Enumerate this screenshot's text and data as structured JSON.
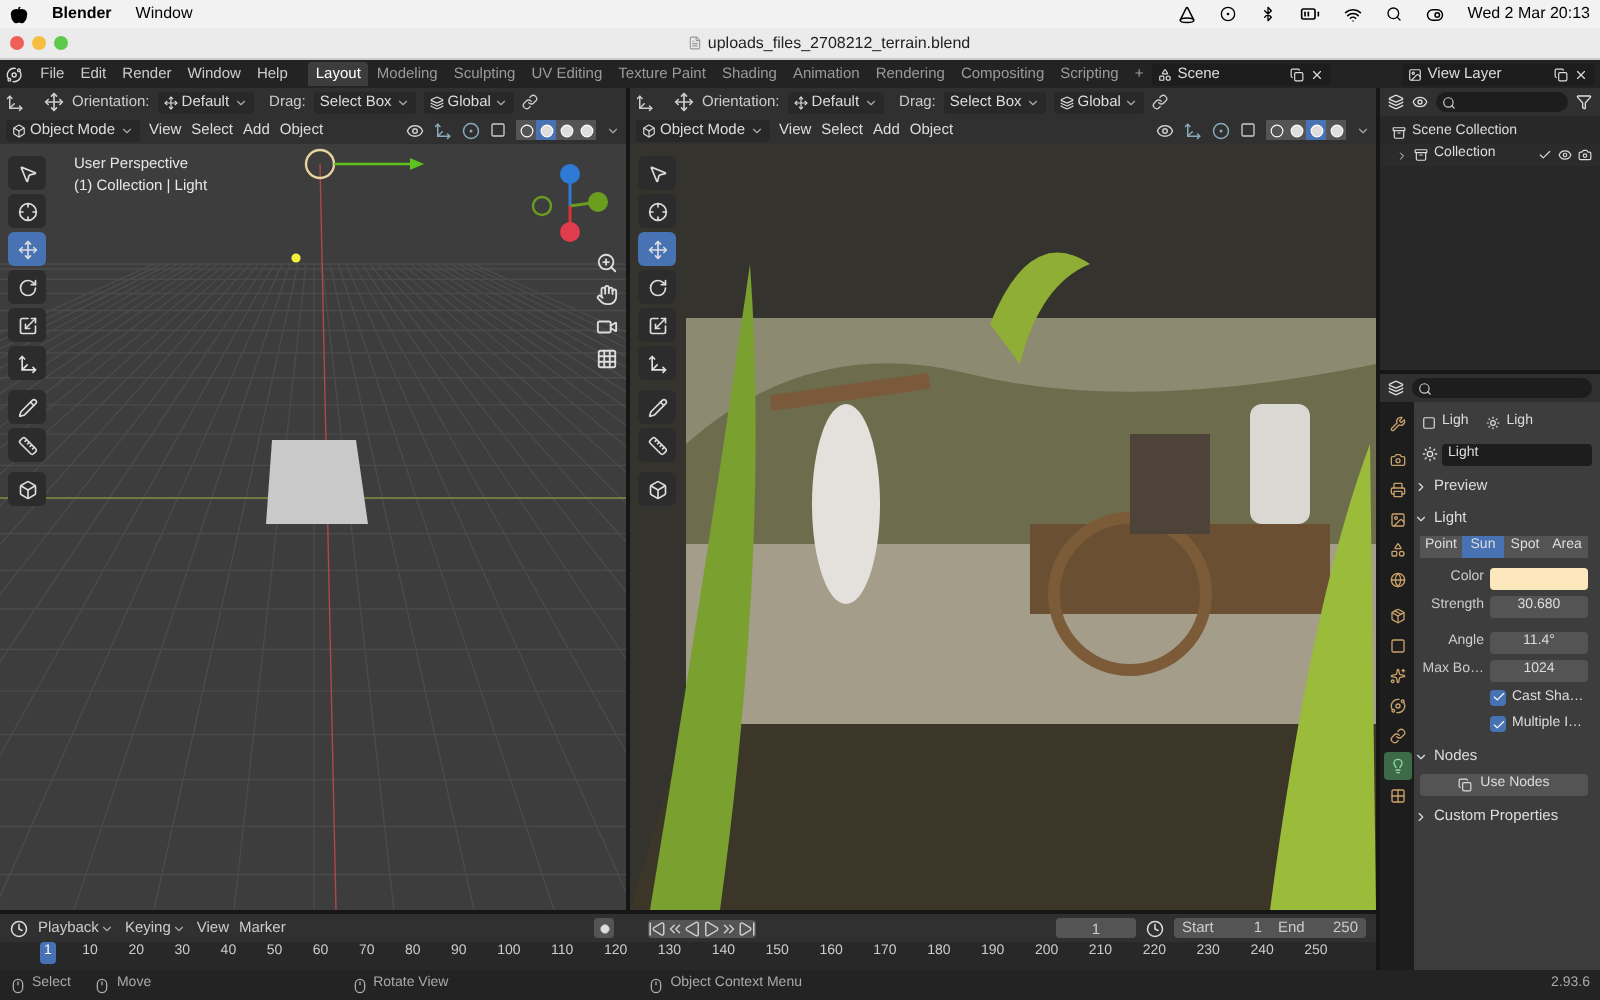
{
  "system_menu_bar": {
    "app_name": "Blender",
    "menus": [
      "Window"
    ],
    "clock": "Wed 2 Mar 20:13"
  },
  "window": {
    "title": "uploads_files_2708212_terrain.blend"
  },
  "top_bar": {
    "menus": [
      "File",
      "Edit",
      "Render",
      "Window",
      "Help"
    ],
    "workspaces": [
      {
        "label": "Layout",
        "selected": true
      },
      {
        "label": "Modeling",
        "selected": false
      },
      {
        "label": "Sculpting",
        "selected": false
      },
      {
        "label": "UV Editing",
        "selected": false
      },
      {
        "label": "Texture Paint",
        "selected": false
      },
      {
        "label": "Shading",
        "selected": false
      },
      {
        "label": "Animation",
        "selected": false
      },
      {
        "label": "Rendering",
        "selected": false
      },
      {
        "label": "Compositing",
        "selected": false
      },
      {
        "label": "Scripting",
        "selected": false
      }
    ],
    "add_workspace": "+",
    "scene": "Scene",
    "view_layer": "View Layer"
  },
  "viewports": [
    {
      "kind": "solid",
      "orientation_label": "Orientation:",
      "orientation": "Default",
      "drag_label": "Drag:",
      "drag": "Select Box",
      "transform": "Global",
      "mode": "Object Mode",
      "menus": [
        "View",
        "Select",
        "Add",
        "Object"
      ],
      "info_lines": [
        "User Perspective",
        "(1) Collection | Light"
      ],
      "tools": [
        {
          "kind": "select",
          "selected": false
        },
        {
          "kind": "cursor",
          "selected": false
        },
        {
          "kind": "move",
          "selected": true
        },
        {
          "kind": "rotate",
          "selected": false
        },
        {
          "kind": "scale",
          "selected": false
        },
        {
          "kind": "transform",
          "selected": false
        },
        {
          "kind": "annotate",
          "selected": false
        },
        {
          "kind": "measure",
          "selected": false
        },
        {
          "kind": "add_cube",
          "selected": false
        }
      ],
      "shading": [
        {
          "selected": false
        },
        {
          "selected": true
        },
        {
          "selected": false
        },
        {
          "selected": false
        }
      ]
    },
    {
      "kind": "rendered",
      "orientation_label": "Orientation:",
      "orientation": "Default",
      "drag_label": "Drag:",
      "drag": "Select Box",
      "transform": "Global",
      "mode": "Object Mode",
      "menus": [
        "View",
        "Select",
        "Add",
        "Object"
      ],
      "tools": [
        {
          "kind": "select",
          "selected": false
        },
        {
          "kind": "cursor",
          "selected": false
        },
        {
          "kind": "move",
          "selected": true
        },
        {
          "kind": "rotate",
          "selected": false
        },
        {
          "kind": "scale",
          "selected": false
        },
        {
          "kind": "transform",
          "selected": false
        },
        {
          "kind": "annotate",
          "selected": false
        },
        {
          "kind": "measure",
          "selected": false
        },
        {
          "kind": "add_cube",
          "selected": false
        }
      ],
      "shading": [
        {
          "selected": false
        },
        {
          "selected": false
        },
        {
          "selected": true
        },
        {
          "selected": false
        }
      ]
    }
  ],
  "outliner": {
    "items": [
      {
        "label": "Scene Collection",
        "children": [
          {
            "label": "Collection",
            "expanded": false
          }
        ]
      }
    ]
  },
  "properties": {
    "tabs": [
      {
        "kind": "tool",
        "selected": false
      },
      {
        "kind": "render",
        "selected": false
      },
      {
        "kind": "output",
        "selected": false
      },
      {
        "kind": "view_layer",
        "selected": false
      },
      {
        "kind": "scene",
        "selected": false
      },
      {
        "kind": "world",
        "selected": false
      },
      {
        "kind": "collection",
        "selected": false
      },
      {
        "kind": "object",
        "selected": false
      },
      {
        "kind": "particles",
        "selected": false
      },
      {
        "kind": "physics",
        "selected": false
      },
      {
        "kind": "constraints",
        "selected": false
      },
      {
        "kind": "data",
        "selected": true
      },
      {
        "kind": "texture",
        "selected": false
      }
    ],
    "object_name": "Ligh",
    "data_name": "Ligh",
    "datablock": "Light",
    "panels": [
      {
        "kind": "preview",
        "title": "Preview",
        "expanded": false
      },
      {
        "kind": "light",
        "title": "Light",
        "expanded": true
      },
      {
        "kind": "nodes",
        "title": "Nodes",
        "expanded": true
      },
      {
        "kind": "custom",
        "title": "Custom Properties",
        "expanded": false
      }
    ],
    "light_types": [
      {
        "label": "Point",
        "selected": false
      },
      {
        "label": "Sun",
        "selected": true
      },
      {
        "label": "Spot",
        "selected": false
      },
      {
        "label": "Area",
        "selected": false
      }
    ],
    "color_label": "Color",
    "color": "#fde8bd",
    "fields": [
      {
        "label": "Strength",
        "value": "30.680"
      },
      {
        "label": "Angle",
        "value": "11.4°"
      },
      {
        "label": "Max Bo…",
        "value": "1024"
      }
    ],
    "checkboxes": [
      {
        "label": "Cast Sha…",
        "checked": true
      },
      {
        "label": "Multiple I…",
        "checked": true
      }
    ],
    "use_nodes": "Use Nodes"
  },
  "timeline": {
    "menus": [
      "Playback",
      "Keying",
      "View",
      "Marker"
    ],
    "current_frame": "1",
    "start_label": "Start",
    "start": "1",
    "end_label": "End",
    "end": "250",
    "ticks": [
      {
        "label": "1",
        "selected": true
      },
      {
        "label": "10",
        "selected": false
      },
      {
        "label": "20",
        "selected": false
      },
      {
        "label": "30",
        "selected": false
      },
      {
        "label": "40",
        "selected": false
      },
      {
        "label": "50",
        "selected": false
      },
      {
        "label": "60",
        "selected": false
      },
      {
        "label": "70",
        "selected": false
      },
      {
        "label": "80",
        "selected": false
      },
      {
        "label": "90",
        "selected": false
      },
      {
        "label": "100",
        "selected": false
      },
      {
        "label": "110",
        "selected": false
      },
      {
        "label": "120",
        "selected": false
      },
      {
        "label": "130",
        "selected": false
      },
      {
        "label": "140",
        "selected": false
      },
      {
        "label": "150",
        "selected": false
      },
      {
        "label": "160",
        "selected": false
      },
      {
        "label": "170",
        "selected": false
      },
      {
        "label": "180",
        "selected": false
      },
      {
        "label": "190",
        "selected": false
      },
      {
        "label": "200",
        "selected": false
      },
      {
        "label": "210",
        "selected": false
      },
      {
        "label": "220",
        "selected": false
      },
      {
        "label": "230",
        "selected": false
      },
      {
        "label": "240",
        "selected": false
      },
      {
        "label": "250",
        "selected": false
      }
    ]
  },
  "status_bar": {
    "hints": [
      "Select",
      "Move",
      "Rotate View",
      "Object Context Menu"
    ],
    "version": "2.93.6"
  }
}
